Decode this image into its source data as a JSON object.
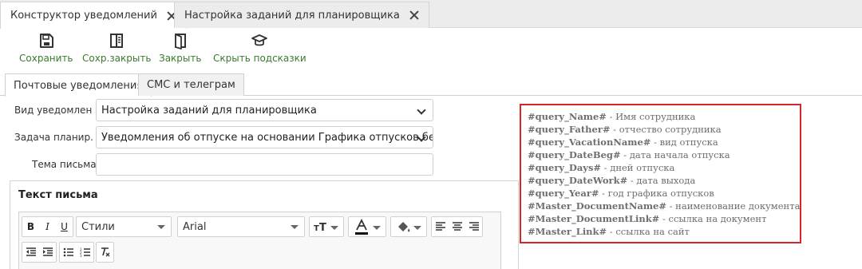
{
  "tabs": [
    {
      "label": "Конструктор уведомлений",
      "active": true
    },
    {
      "label": "Настройка заданий для планировщика",
      "active": false
    }
  ],
  "toolbar": {
    "save": "Сохранить",
    "save_close": "Сохр.закрыть",
    "close": "Закрыть",
    "hide_hints": "Скрыть подсказки"
  },
  "section_tabs": {
    "email": "Почтовые уведомления",
    "sms": "СМС и телеграм"
  },
  "form": {
    "notification_type_label": "Вид уведомлен...",
    "notification_type_value": "Настройка заданий для планировщика",
    "scheduler_task_label": "Задача планир...",
    "scheduler_task_value": "Уведомления об отпуске на основании Графика отпусков бе",
    "subject_label": "Тема письма",
    "subject_value": ""
  },
  "editor": {
    "title": "Текст письма",
    "styles_combo": "Стили",
    "font_combo": "Arial",
    "bold": "B",
    "italic": "I",
    "underline": "U"
  },
  "hints": [
    {
      "tag": "#query_Name#",
      "text": " - Имя сотрудника"
    },
    {
      "tag": "#query_Father#",
      "text": " - отчество сотрудника"
    },
    {
      "tag": "#query_VacationName#",
      "text": " - вид отпуска"
    },
    {
      "tag": "#query_DateBeg#",
      "text": " - дата начала отпуска"
    },
    {
      "tag": "#query_Days#",
      "text": " - дней отпуска"
    },
    {
      "tag": "#query_DateWork#",
      "text": " - дата выхода"
    },
    {
      "tag": "#query_Year#",
      "text": " - год графика отпусков"
    },
    {
      "tag": "#Master_DocumentName#",
      "text": " - наименование документа"
    },
    {
      "tag": "#Master_DocumentLink#",
      "text": " - ссылка на документ"
    },
    {
      "tag": "#Master_Link#",
      "text": " - ссылка на сайт"
    }
  ],
  "colors": {
    "accent_green": "#3a7a2e",
    "hint_border": "#d9242a"
  }
}
